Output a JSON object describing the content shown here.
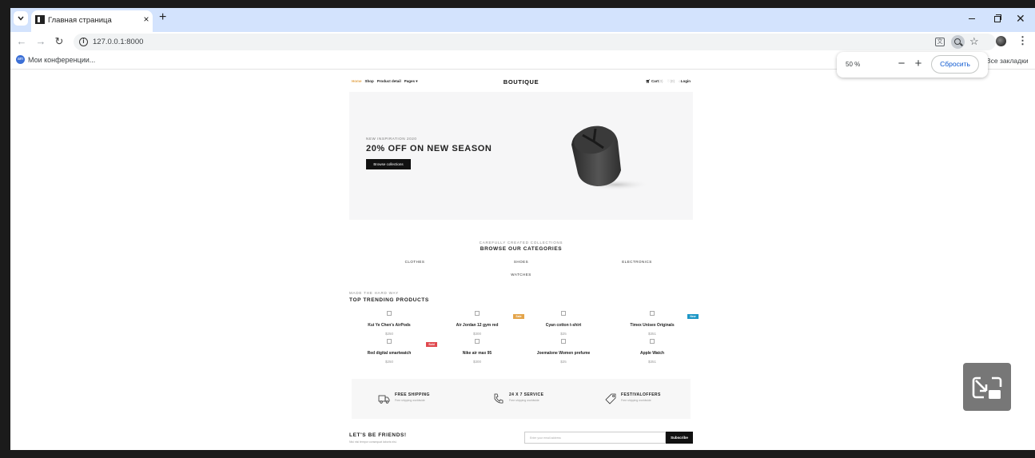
{
  "browser": {
    "tab_title": "Главная страница",
    "url": "127.0.0.1:8000",
    "bookmark_label": "Мои конференции...",
    "bookmark_icon_text": "am",
    "all_bookmarks": "Все закладки",
    "translate_icon_text": "文"
  },
  "zoom_popup": {
    "level": "50 %",
    "reset_label": "Сбросить"
  },
  "site": {
    "nav": [
      "Home",
      "Shop",
      "Product detail",
      "Pages ▾"
    ],
    "brand": "BOUTIQUE",
    "cart": "Cart",
    "cart_count": "(0)",
    "wishlist": "(0)",
    "login": "Login"
  },
  "hero": {
    "eyebrow": "NEW INSPIRATION 2020",
    "title": "20% OFF ON NEW SEASON",
    "button": "Browse collections"
  },
  "categories": {
    "eyebrow": "CAREFULLY CREATED COLLECTIONS",
    "title": "BROWSE OUR CATEGORIES",
    "items": [
      "CLOTHES",
      "SHOES",
      "ELECTRONICS",
      "WATCHES"
    ]
  },
  "trending": {
    "eyebrow": "MADE THE HARD WAY",
    "title": "TOP TRENDING PRODUCTS",
    "products": [
      {
        "name": "Kui Ye Chen's AirPods",
        "price": "$250"
      },
      {
        "name": "Air Jordan 12 gym red",
        "price": "$300",
        "badge": "Sale"
      },
      {
        "name": "Cyan cotton t-shirt",
        "price": "$25"
      },
      {
        "name": "Timex Unisex Originals",
        "price": "$351",
        "badge": "New"
      },
      {
        "name": "Red digital smartwatch",
        "price": "$250",
        "badge": "Sold"
      },
      {
        "name": "Nike air max 95",
        "price": "$300"
      },
      {
        "name": "Joemalone Women prefume",
        "price": "$25"
      },
      {
        "name": "Apple Watch",
        "price": "$351"
      }
    ]
  },
  "services": [
    {
      "title": "FREE SHIPPING",
      "subtitle": "Free shipping worldwide"
    },
    {
      "title": "24 X 7 SERVICE",
      "subtitle": "Free shipping worldwide"
    },
    {
      "title": "FESTIVALOFFERS",
      "subtitle": "Free shipping worldwide"
    }
  ],
  "newsletter": {
    "title": "LET'S BE FRIENDS!",
    "subtitle": "Nisi nisi tempor consequat laboris nisi.",
    "placeholder": "Enter your email address",
    "button": "Subscribe"
  },
  "colors": {
    "accent": "#e3a44a",
    "badge_sale": "#e3a44a",
    "badge_new": "#1d97c6",
    "badge_sold": "#e0484e",
    "tabstrip": "#d3e3fd"
  }
}
